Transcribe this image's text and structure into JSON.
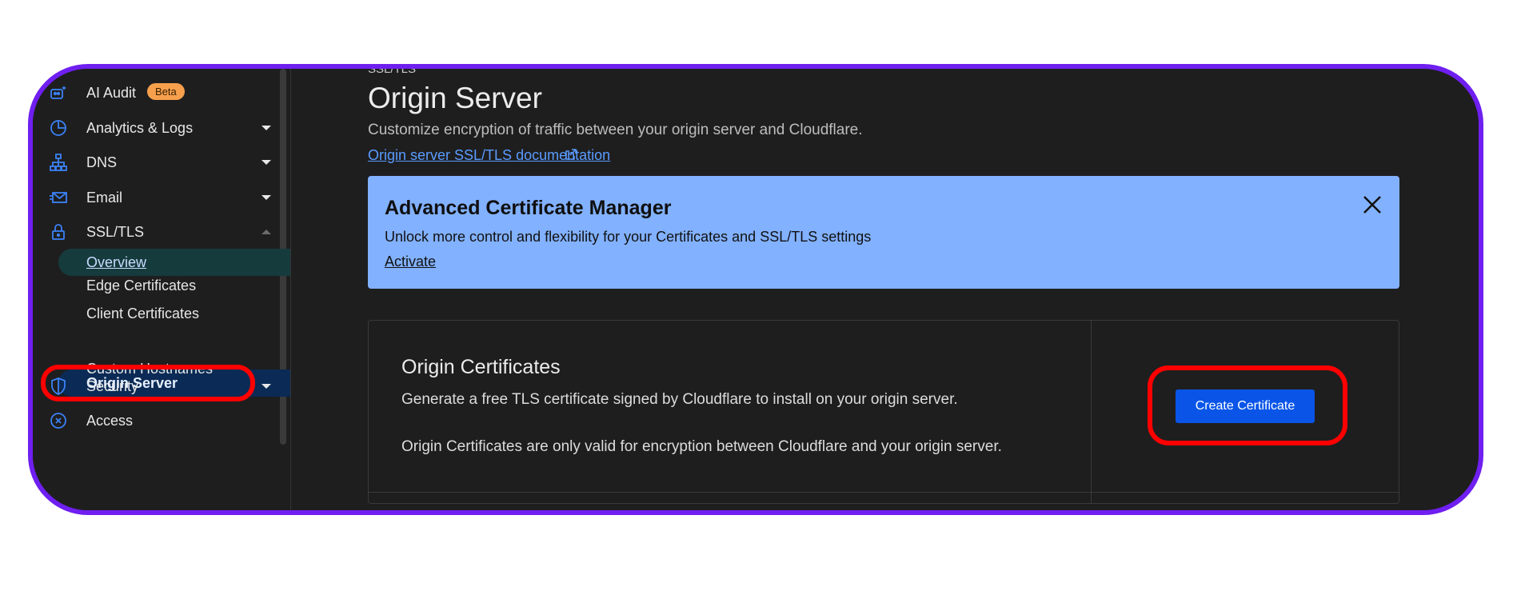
{
  "sidebar": {
    "items": [
      {
        "label": "AI Audit",
        "badge": "Beta",
        "icon": "robot-icon"
      },
      {
        "label": "Analytics & Logs",
        "icon": "chart-pie-icon"
      },
      {
        "label": "DNS",
        "icon": "network-icon"
      },
      {
        "label": "Email",
        "icon": "email-icon"
      },
      {
        "label": "SSL/TLS",
        "icon": "lock-icon"
      }
    ],
    "ssl_sub": [
      "Overview",
      "Edge Certificates",
      "Client Certificates",
      "Origin Server",
      "Custom Hostnames"
    ],
    "after": [
      {
        "label": "Security",
        "icon": "shield-icon"
      },
      {
        "label": "Access",
        "icon": "access-icon"
      }
    ]
  },
  "main": {
    "breadcrumb": "SSL/TLS",
    "title": "Origin Server",
    "description": "Customize encryption of traffic between your origin server and Cloudflare.",
    "doc_link": "Origin server SSL/TLS documentation",
    "banner": {
      "title": "Advanced Certificate Manager",
      "description": "Unlock more control and flexibility for your Certificates and SSL/TLS settings",
      "action": "Activate"
    },
    "card": {
      "title": "Origin Certificates",
      "p1": "Generate a free TLS certificate signed by Cloudflare to install on your origin server.",
      "p2": "Origin Certificates are only valid for encryption between Cloudflare and your origin server.",
      "button": "Create Certificate"
    }
  },
  "colors": {
    "frame": "#6f1ff0",
    "highlight": "#ff0000",
    "accent": "#0a55e8",
    "banner": "#82b1ff"
  }
}
